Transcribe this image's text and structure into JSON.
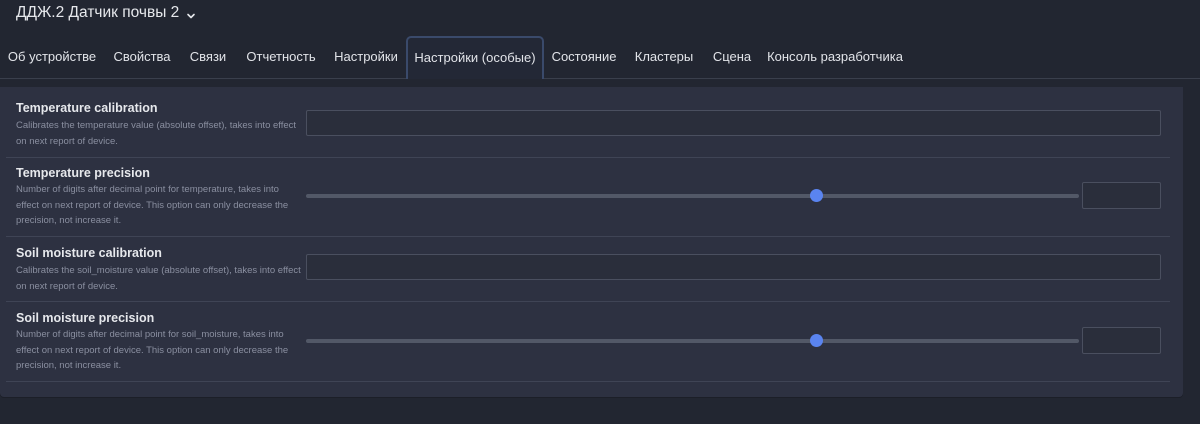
{
  "header": {
    "device_title": "ДДЖ.2 Датчик почвы 2"
  },
  "tabs": [
    {
      "label": "Об устройстве",
      "active": false
    },
    {
      "label": "Свойства",
      "active": false
    },
    {
      "label": "Связи",
      "active": false
    },
    {
      "label": "Отчетность",
      "active": false
    },
    {
      "label": "Настройки",
      "active": false
    },
    {
      "label": "Настройки (особые)",
      "active": true
    },
    {
      "label": "Состояние",
      "active": false
    },
    {
      "label": "Кластеры",
      "active": false
    },
    {
      "label": "Сцена",
      "active": false
    },
    {
      "label": "Консоль разработчика",
      "active": false
    }
  ],
  "settings": {
    "temperature_calibration": {
      "title": "Temperature calibration",
      "description": "Calibrates the temperature value (absolute offset), takes into effect on next report of device.",
      "value": ""
    },
    "temperature_precision": {
      "title": "Temperature precision",
      "description": "Number of digits after decimal point for temperature, takes into effect on next report of device. This option can only decrease the precision, not increase it.",
      "slider_fraction": 0.66,
      "value": ""
    },
    "soil_moisture_calibration": {
      "title": "Soil moisture calibration",
      "description": "Calibrates the soil_moisture value (absolute offset), takes into effect on next report of device.",
      "value": ""
    },
    "soil_moisture_precision": {
      "title": "Soil moisture precision",
      "description": "Number of digits after decimal point for soil_moisture, takes into effect on next report of device. This option can only decrease the precision, not increase it.",
      "slider_fraction": 0.66,
      "value": ""
    }
  },
  "colors": {
    "background": "#222631",
    "panel": "#2d3141",
    "accent": "#5a84f0",
    "active_tab_border": "#3a4a6b"
  }
}
